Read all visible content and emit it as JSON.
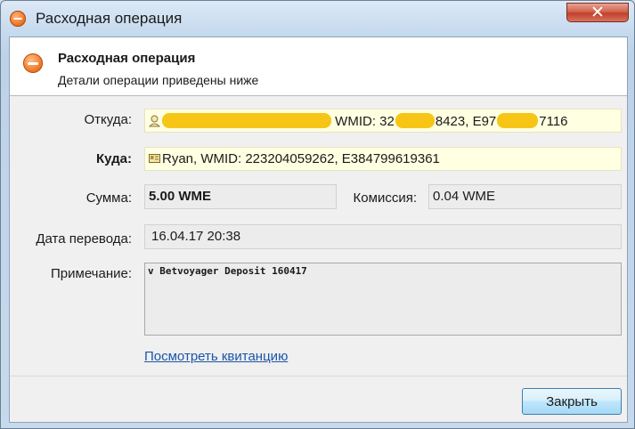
{
  "window": {
    "title": "Расходная операция",
    "close_glyph": "✕"
  },
  "header": {
    "title": "Расходная операция",
    "subtitle": "Детали операции приведены ниже",
    "icon": "minus-circle-icon"
  },
  "from": {
    "label": "Откуда:",
    "icon": "person-icon",
    "wmid_prefix": "WMID: 32",
    "wmid_mid": "8423, E97",
    "wmid_end": "7116",
    "redaction_color": "#f7c515"
  },
  "to": {
    "label": "Куда:",
    "icon": "passport-card-icon",
    "value": "Ryan, WMID: 223204059262, E384799619361"
  },
  "amount": {
    "label": "Сумма:",
    "value": "5.00 WME"
  },
  "commission": {
    "label": "Комиссия:",
    "value": "0.04 WME"
  },
  "date": {
    "label": "Дата перевода:",
    "value": "16.04.17 20:38"
  },
  "note": {
    "label": "Примечание:",
    "value": "v Betvoyager Deposit 160417"
  },
  "receipt_link": "Посмотреть квитанцию",
  "close_button": "Закрыть",
  "colors": {
    "link": "#1a55a8",
    "field_yellow": "#ffffe1",
    "field_grey": "#ececec",
    "accent_orange": "#f07a2a"
  }
}
